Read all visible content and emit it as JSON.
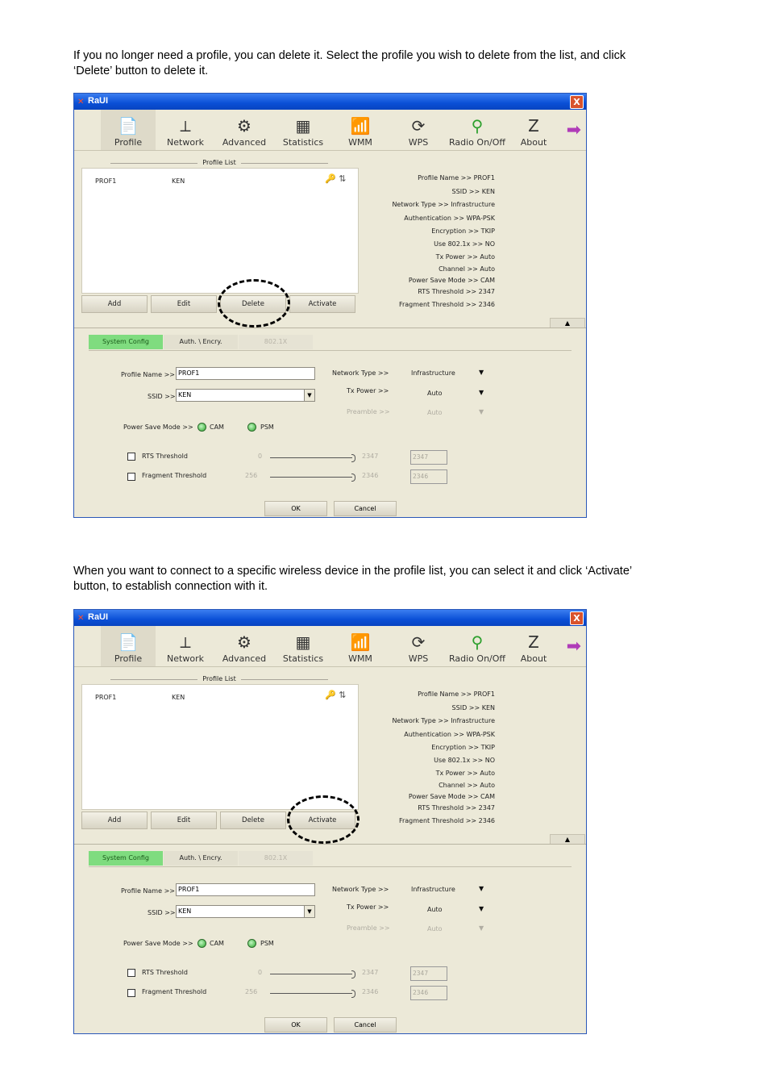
{
  "doc": {
    "para1_line1": "If you no longer need a profile, you can delete it. Select the profile you wish to delete from the list, and click",
    "para1_line2": "‘Delete’ button to delete it.",
    "para2_line1": "When you want to connect to a specific wireless device in the profile list, you can select it and click ‘Activate’",
    "para2_line2": "button, to establish connection with it."
  },
  "app": {
    "title": "RaUI",
    "close": "X",
    "toolbar": [
      "Profile",
      "Network",
      "Advanced",
      "Statistics",
      "WMM",
      "WPS",
      "Radio On/Off",
      "About"
    ],
    "toolbar_icons": [
      "📄",
      "⟂",
      "⚙",
      "▦",
      "📶",
      "⟳",
      "⚲",
      "Z"
    ],
    "profile_list_title": "Profile List",
    "profile_row": {
      "name": "PROF1",
      "ssid": "KEN",
      "icons": "🔑 ⇅"
    },
    "buttons": [
      "Add",
      "Edit",
      "Delete",
      "Activate"
    ],
    "details": [
      "Profile Name >> PROF1",
      "SSID >> KEN",
      "Network Type >> Infrastructure",
      "Authentication >> WPA-PSK",
      "Encryption >> TKIP",
      "Use 802.1x >> NO",
      "Tx Power >> Auto",
      "Channel >> Auto",
      "Power Save Mode >> CAM",
      "RTS Threshold >> 2347",
      "Fragment Threshold >> 2346"
    ],
    "collapse": "▲",
    "tabs": [
      "System Config",
      "Auth. \\ Encry.",
      "802.1X"
    ],
    "form": {
      "profile_name_label": "Profile Name >>",
      "profile_name_value": "PROF1",
      "ssid_label": "SSID >>",
      "ssid_value": "KEN",
      "ssid_dropdown": "▼",
      "network_type_label": "Network Type >>",
      "network_type_value": "Infrastructure",
      "tx_power_label": "Tx Power >>",
      "tx_power_value": "Auto",
      "preamble_label": "Preamble >>",
      "preamble_value": "Auto",
      "select_arrow": "▼",
      "psm_label": "Power Save Mode >>",
      "cam": "CAM",
      "psm": "PSM",
      "rts_label": "RTS Threshold",
      "rts_min": "0",
      "rts_max": "2347",
      "rts_value": "2347",
      "frag_label": "Fragment Threshold",
      "frag_min": "256",
      "frag_max": "2346",
      "frag_value": "2346",
      "ok": "OK",
      "cancel": "Cancel"
    }
  }
}
